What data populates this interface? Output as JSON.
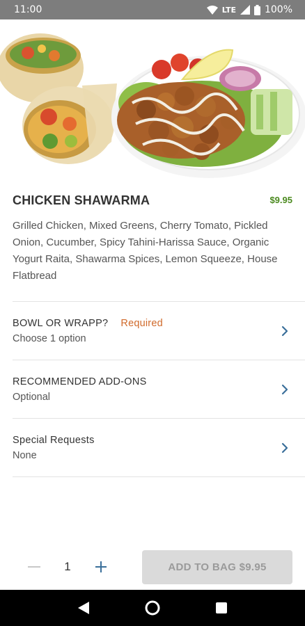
{
  "status_bar": {
    "time": "11:00",
    "network": "LTE",
    "battery": "100%"
  },
  "item": {
    "title": "CHICKEN SHAWARMA",
    "price": "$9.95",
    "description": "Grilled Chicken, Mixed Greens, Cherry Tomato, Pickled Onion, Cucumber, Spicy Tahini-Harissa Sauce, Organic Yogurt Raita, Shawarma Spices, Lemon Squeeze, House Flatbread"
  },
  "options": [
    {
      "title": "BOWL OR WRAPP?",
      "badge": "Required",
      "subtitle": "Choose 1 option"
    },
    {
      "title": "RECOMMENDED ADD-ONS",
      "subtitle": "Optional"
    },
    {
      "title": "Special Requests",
      "subtitle": "None"
    }
  ],
  "quantity": {
    "value": "1"
  },
  "add_to_bag": {
    "label": "ADD TO BAG $9.95"
  },
  "icons": {
    "minus": "minus-icon",
    "plus": "plus-icon",
    "chevron": "chevron-right-icon",
    "back": "back-icon",
    "home": "home-icon",
    "recents": "recents-icon"
  },
  "colors": {
    "price": "#4b8a1f",
    "required": "#d06a2b",
    "accent": "#3a6f9a",
    "button_disabled": "#dadada"
  }
}
